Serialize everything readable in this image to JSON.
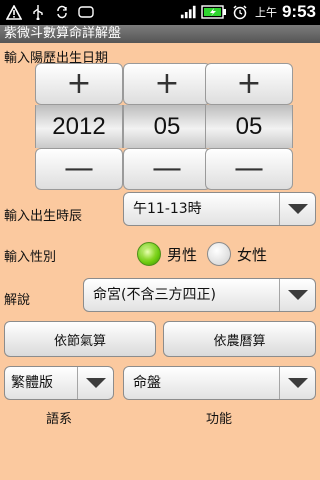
{
  "status_bar": {
    "icons": [
      "warning-icon",
      "usb-icon",
      "sync-icon",
      "screenshot-icon",
      "signal-icon",
      "battery-icon",
      "alarm-icon"
    ],
    "ampm": "上午",
    "time": "9:53"
  },
  "app": {
    "title": "紫微斗數算命詳解盤"
  },
  "birthdate": {
    "label": "輸入陽歷出生日期",
    "year": "2012",
    "month": "05",
    "day": "05",
    "plus": "+",
    "minus": "—"
  },
  "birth_time": {
    "label": "輸入出生時辰",
    "value": "午11-13時"
  },
  "gender": {
    "label": "輸入性別",
    "options": [
      "男性",
      "女性"
    ],
    "selected": "男性"
  },
  "explain": {
    "label": "解說",
    "value": "命宮(不含三方四正)"
  },
  "buttons": {
    "solar_term": "依節氣算",
    "lunar": "依農曆算"
  },
  "system": {
    "value": "繁體版",
    "caption": "語系"
  },
  "function": {
    "value": "命盤",
    "caption": "功能"
  },
  "colors": {
    "background": "#fbc99f",
    "radio_selected": "#6fcc10"
  }
}
